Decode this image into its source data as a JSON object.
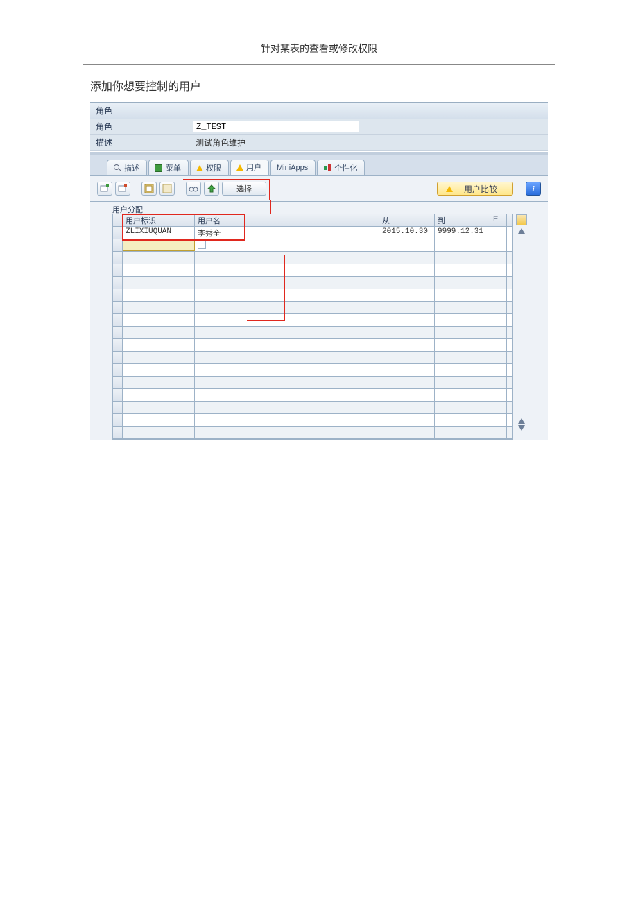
{
  "doc": {
    "title": "针对某表的查看或修改权限",
    "subtitle": "添加你想要控制的用户"
  },
  "header": {
    "panel_label": "角色",
    "role_label": "角色",
    "role_value": "Z_TEST",
    "desc_label": "描述",
    "desc_value": "测试角色维护"
  },
  "tabs": {
    "t1": "描述",
    "t2": "菜单",
    "t3": "权限",
    "t4": "用户",
    "t5": "MiniApps",
    "t6": "个性化"
  },
  "toolbar": {
    "select": "选择",
    "compare": "用户比较",
    "info": "i"
  },
  "group": {
    "legend": "用户分配"
  },
  "table": {
    "col_id": "用户标识",
    "col_name": "用户名",
    "col_from": "从",
    "col_to": "到",
    "col_ext": "E",
    "rows": [
      {
        "id": "ZLIXIUQUAN",
        "name": "李秀全",
        "from": "2015.10.30",
        "to": "9999.12.31",
        "ext": ""
      }
    ]
  }
}
